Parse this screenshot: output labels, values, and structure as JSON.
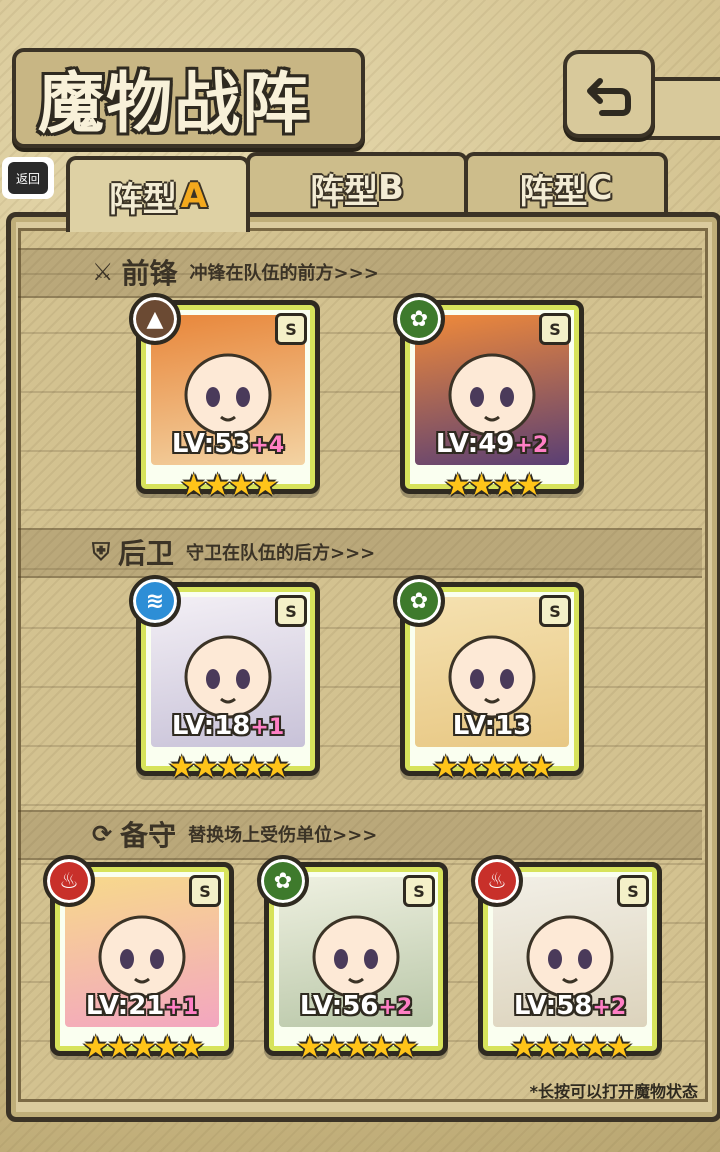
{
  "header": {
    "title": "魔物战阵",
    "back_icon_label": "⮌"
  },
  "overlay": {
    "back_badge": "返回"
  },
  "tabs": [
    {
      "prefix": "阵型",
      "letter": "A",
      "active": true
    },
    {
      "prefix": "阵型",
      "letter": "B",
      "active": false
    },
    {
      "prefix": "阵型",
      "letter": "C",
      "active": false
    }
  ],
  "sections": {
    "front": {
      "title": "前锋",
      "subtitle": "冲锋在队伍的前方>>>"
    },
    "rear": {
      "title": "后卫",
      "subtitle": "守卫在队伍的后方>>>"
    },
    "reserve": {
      "title": "备守",
      "subtitle": "替换场上受伤单位>>>"
    }
  },
  "cards": [
    {
      "grade": "S",
      "element": "earth",
      "level": "LV:53",
      "plus": "+4",
      "stars": 4,
      "colors": [
        "#e8863a",
        "#f3d3a3"
      ]
    },
    {
      "grade": "S",
      "element": "wind",
      "level": "LV:49",
      "plus": "+2",
      "stars": 4,
      "colors": [
        "#f08a3a",
        "#5a3f74"
      ]
    },
    {
      "grade": "S",
      "element": "water",
      "level": "LV:18",
      "plus": "+1",
      "stars": 5,
      "colors": [
        "#f3eff5",
        "#c8c2d8"
      ]
    },
    {
      "grade": "S",
      "element": "wind",
      "level": "LV:13",
      "plus": "",
      "stars": 5,
      "colors": [
        "#f5e1b0",
        "#e8c884"
      ]
    },
    {
      "grade": "S",
      "element": "fire",
      "level": "LV:21",
      "plus": "+1",
      "stars": 5,
      "colors": [
        "#f7d98b",
        "#f3a6c0"
      ]
    },
    {
      "grade": "S",
      "element": "wind",
      "level": "LV:56",
      "plus": "+2",
      "stars": 5,
      "colors": [
        "#eef0e0",
        "#b9c7a8"
      ]
    },
    {
      "grade": "S",
      "element": "fire",
      "level": "LV:58",
      "plus": "+2",
      "stars": 5,
      "colors": [
        "#f2efe6",
        "#dcd3bc"
      ]
    }
  ],
  "element_colors": {
    "earth": "#6b4a33",
    "wind": "#3e7a2c",
    "water": "#2d8ed6",
    "fire": "#c8302a"
  },
  "element_glyphs": {
    "earth": "▲",
    "wind": "✿",
    "water": "≋",
    "fire": "♨"
  },
  "footer": {
    "hint": "*长按可以打开魔物状态"
  }
}
